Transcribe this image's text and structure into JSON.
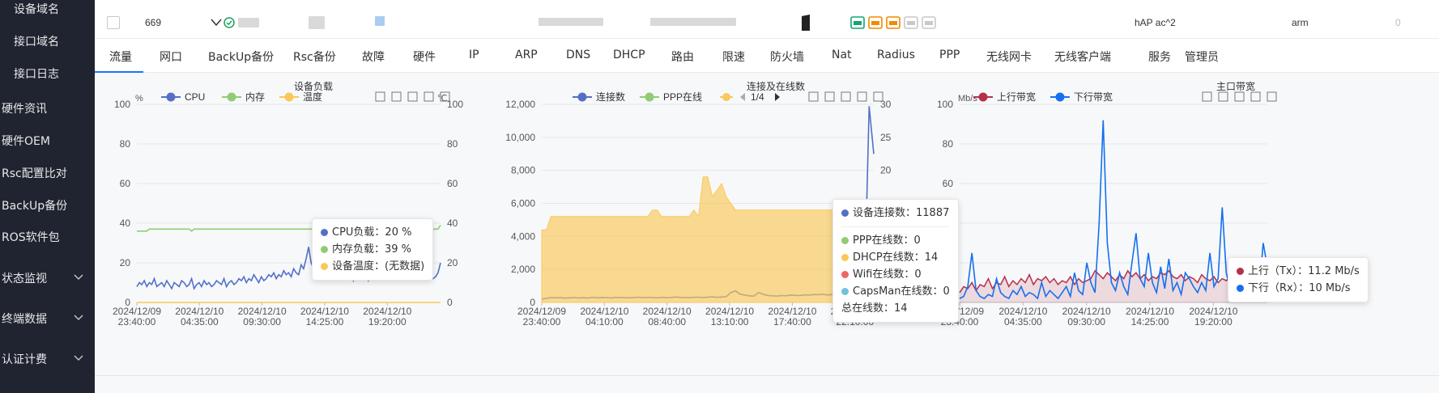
{
  "sidebar": {
    "items": [
      {
        "label": "设备域名",
        "indent": true
      },
      {
        "label": "接口域名",
        "indent": true
      },
      {
        "label": "接口日志",
        "indent": true
      },
      {
        "label": "硬件资讯"
      },
      {
        "label": "硬件OEM"
      },
      {
        "label": "Rsc配置比对"
      },
      {
        "label": "BackUp备份"
      },
      {
        "label": "ROS软件包"
      }
    ],
    "groups": [
      {
        "label": "状态监视",
        "icon": "chevron-down-icon"
      },
      {
        "label": "终端数据",
        "icon": "chevron-down-icon"
      },
      {
        "label": "认证计费",
        "icon": "chevron-down-icon"
      }
    ]
  },
  "device_row": {
    "id": "669",
    "model": "hAP ac^2",
    "arch": "arm",
    "count": "0",
    "status_colors": {
      "ok": "#19a15f",
      "port_active": "#f08c00",
      "port_inactive": "#c9c9c9",
      "port_up": "#18a374"
    }
  },
  "tabs": [
    "流量",
    "网口",
    "BackUp备份",
    "Rsc备份",
    "故障",
    "硬件",
    "IP",
    "ARP",
    "DNS",
    "DHCP",
    "路由",
    "限速",
    "防火墙",
    "Nat",
    "Radius",
    "PPP",
    "无线网卡",
    "无线客户端",
    "服务",
    "管理员"
  ],
  "active_tab": "流量",
  "panels": {
    "load": {
      "title": "设备负载"
    },
    "conn": {
      "title": "连接及在线数"
    },
    "bw": {
      "title": "主口带宽"
    }
  },
  "chart_data": [
    {
      "type": "line",
      "title": "设备负载",
      "ylabel_left": "%",
      "ylabel_right": "℃",
      "ylim": [
        0,
        100
      ],
      "ylim_right": [
        0,
        100
      ],
      "yticks": [
        0,
        20,
        40,
        60,
        80,
        100
      ],
      "xtick_labels": [
        [
          "2024/12/09",
          "23:40:00"
        ],
        [
          "2024/12/10",
          "04:35:00"
        ],
        [
          "2024/12/10",
          "09:30:00"
        ],
        [
          "2024/12/10",
          "14:25:00"
        ],
        [
          "2024/12/10",
          "19:20:00"
        ]
      ],
      "legend": [
        "CPU",
        "内存",
        "温度"
      ],
      "series": [
        {
          "name": "CPU",
          "color": "#5470c6",
          "values": [
            8,
            10,
            9,
            11,
            8,
            10,
            9,
            12,
            8,
            9,
            10,
            8,
            11,
            9,
            7,
            10,
            9,
            8,
            11,
            10,
            8,
            9,
            12,
            7,
            9,
            10,
            8,
            11,
            9,
            10,
            8,
            9,
            11,
            10,
            9,
            12,
            8,
            10,
            11,
            9,
            10,
            12,
            11,
            13,
            10,
            12,
            11,
            14,
            12,
            10,
            13,
            11,
            12,
            14,
            13,
            15,
            12,
            14,
            13,
            16,
            14,
            15,
            13,
            17,
            15,
            14,
            19,
            17,
            22,
            28,
            20,
            17,
            19,
            15,
            18,
            14,
            22,
            18,
            16,
            14,
            17,
            12,
            15,
            13,
            16,
            12,
            15,
            11,
            14,
            13,
            16,
            12,
            15,
            11,
            13,
            12,
            15,
            13,
            14,
            12,
            15,
            13,
            14,
            12,
            13,
            14,
            12,
            15,
            13,
            14,
            12,
            13,
            15,
            14,
            12,
            14,
            13,
            15,
            14,
            12,
            13,
            15,
            20
          ]
        },
        {
          "name": "内存",
          "color": "#91cc75",
          "values": [
            36,
            36,
            36,
            36,
            36,
            37,
            37,
            37,
            37,
            37,
            37,
            37,
            37,
            37,
            37,
            37,
            37,
            37,
            37,
            37,
            37,
            37,
            36,
            37,
            37,
            37,
            37,
            37,
            37,
            37,
            37,
            37,
            37,
            37,
            37,
            37,
            37,
            37,
            37,
            37,
            37,
            37,
            37,
            37,
            37,
            37,
            37,
            37,
            37,
            37,
            37,
            37,
            37,
            37,
            37,
            37,
            37,
            37,
            37,
            37,
            37,
            37,
            37,
            37,
            37,
            37,
            37,
            37,
            37,
            37,
            37,
            37,
            37,
            37,
            37,
            37,
            37,
            37,
            37,
            37,
            37,
            37,
            37,
            37,
            37,
            37,
            37,
            37,
            37,
            37,
            37,
            37,
            37,
            37,
            37,
            37,
            37,
            37,
            37,
            37,
            37,
            37,
            37,
            37,
            37,
            37,
            37,
            37,
            37,
            37,
            37,
            37,
            37,
            37,
            37,
            37,
            37,
            37,
            37,
            37,
            37,
            37,
            39
          ]
        },
        {
          "name": "温度",
          "color": "#fac858",
          "values": [
            0,
            0,
            0,
            0,
            0,
            0,
            0,
            0,
            0,
            0,
            0,
            0,
            0,
            0,
            0,
            0,
            0,
            0,
            0,
            0,
            0,
            0,
            0,
            0,
            0,
            0,
            0,
            0,
            0,
            0,
            0,
            0,
            0,
            0,
            0,
            0,
            0,
            0,
            0,
            0,
            0,
            0,
            0,
            0,
            0,
            0,
            0,
            0,
            0,
            0,
            0,
            0,
            0,
            0,
            0,
            0,
            0,
            0,
            0,
            0,
            0,
            0,
            0,
            0,
            0,
            0,
            0,
            0,
            0,
            0,
            0,
            0,
            0,
            0,
            0,
            0,
            0,
            0,
            0,
            0,
            0,
            0,
            0,
            0,
            0,
            0,
            0,
            0,
            0,
            0,
            0,
            0,
            0,
            0,
            0,
            0,
            0,
            0,
            0,
            0,
            0,
            0,
            0,
            0,
            0,
            0,
            0,
            0,
            0,
            0,
            0,
            0,
            0,
            0,
            0,
            0,
            0,
            0,
            0,
            0,
            0,
            0,
            0
          ]
        }
      ],
      "tooltip": [
        {
          "label": "CPU负载：20 %",
          "color": "#5470c6"
        },
        {
          "label": "内存负载：39 %",
          "color": "#91cc75"
        },
        {
          "label": "设备温度：(无数据)",
          "color": "#fac858"
        }
      ]
    },
    {
      "type": "area",
      "title": "连接及在线数",
      "ylim": [
        0,
        12000
      ],
      "ylim_right": [
        0,
        30
      ],
      "yticks": [
        0,
        2000,
        4000,
        6000,
        8000,
        10000,
        12000
      ],
      "yticks_right": [
        0,
        5,
        10,
        15,
        20,
        25,
        30
      ],
      "xtick_labels": [
        [
          "2024/12/09",
          "23:40:00"
        ],
        [
          "2024/12/10",
          "04:10:00"
        ],
        [
          "2024/12/10",
          "08:40:00"
        ],
        [
          "2024/12/10",
          "13:10:00"
        ],
        [
          "2024/12/10",
          "17:40:00"
        ],
        [
          "2024/12/10",
          "22:10:00"
        ]
      ],
      "legend": [
        "连接数",
        "PPP在线"
      ],
      "legend_page": "1/4",
      "series": [
        {
          "name": "连接数",
          "color": "#5470c6",
          "axis": "left",
          "values": [
            200,
            250,
            300,
            280,
            300,
            260,
            280,
            300,
            270,
            290,
            260,
            310,
            280,
            300,
            290,
            270,
            310,
            300,
            290,
            280,
            300,
            320,
            290,
            310,
            300,
            280,
            310,
            290,
            300,
            330,
            310,
            300,
            290,
            310,
            320,
            300,
            320,
            340,
            310,
            330,
            350,
            600,
            700,
            500,
            450,
            400,
            380,
            600,
            500,
            420,
            400,
            380,
            420,
            400,
            450,
            430,
            420,
            460,
            440,
            480,
            470,
            500,
            450,
            480,
            500,
            460,
            520,
            480,
            500,
            650,
            700,
            11887,
            9000
          ]
        },
        {
          "name": "DHCP在线",
          "color": "#fac858",
          "axis": "right",
          "values": [
            11,
            11,
            13,
            13,
            13,
            13,
            13,
            13,
            13,
            13,
            13,
            13,
            13,
            13,
            13,
            13,
            13,
            13,
            13,
            13,
            13,
            13,
            13,
            13,
            14,
            14,
            13,
            13,
            13,
            13,
            13,
            13,
            13,
            14,
            13,
            19,
            19,
            16,
            17,
            18,
            16,
            15,
            14,
            14,
            14,
            14,
            14,
            14,
            14,
            14,
            14,
            14,
            14,
            14,
            14,
            14,
            14,
            14,
            14,
            14,
            14,
            14,
            14,
            14,
            14,
            14,
            14,
            14,
            14,
            14,
            14,
            14,
            14
          ]
        }
      ],
      "tooltip": [
        {
          "label": "设备连接数：11887",
          "color": "#5470c6"
        },
        {
          "sep": true
        },
        {
          "label": "PPP在线数：0",
          "color": "#91cc75"
        },
        {
          "label": "DHCP在线数：14",
          "color": "#fac858"
        },
        {
          "label": "Wifi在线数：0",
          "color": "#ee6666"
        },
        {
          "label": "CapsMan在线数：0",
          "color": "#73c0de"
        },
        {
          "label": "总在线数：14"
        }
      ]
    },
    {
      "type": "line",
      "title": "主口带宽",
      "ylabel_left": "Mb/s",
      "ylim": [
        0,
        100
      ],
      "yticks": [
        0,
        20,
        40,
        60,
        80,
        100
      ],
      "xtick_labels": [
        [
          "2024/12/09",
          "23:40:00"
        ],
        [
          "2024/12/10",
          "04:35:00"
        ],
        [
          "2024/12/10",
          "09:30:00"
        ],
        [
          "2024/12/10",
          "14:25:00"
        ],
        [
          "2024/12/10",
          "19:20:00"
        ]
      ],
      "legend": [
        "上行带宽",
        "下行带宽"
      ],
      "series": [
        {
          "name": "上行带宽",
          "color": "#b5304a",
          "values": [
            5,
            8,
            7,
            10,
            6,
            9,
            8,
            12,
            7,
            10,
            9,
            13,
            8,
            11,
            9,
            12,
            10,
            14,
            9,
            12,
            11,
            13,
            10,
            12,
            9,
            11,
            10,
            13,
            9,
            12,
            10,
            11,
            12,
            16,
            14,
            12,
            15,
            13,
            11,
            14,
            12,
            16,
            13,
            15,
            12,
            14,
            11,
            13,
            12,
            15,
            14,
            16,
            13,
            12,
            14,
            11,
            13,
            12,
            10,
            14,
            12,
            11,
            13,
            10,
            12,
            11,
            13,
            9,
            12,
            11,
            13,
            10,
            12,
            11,
            9,
            11
          ]
        },
        {
          "name": "下行带宽",
          "color": "#1570ef",
          "values": [
            2,
            3,
            8,
            25,
            6,
            3,
            2,
            4,
            3,
            12,
            5,
            3,
            2,
            6,
            4,
            8,
            3,
            5,
            4,
            2,
            10,
            3,
            6,
            4,
            2,
            5,
            8,
            3,
            15,
            6,
            4,
            20,
            10,
            5,
            40,
            92,
            30,
            10,
            6,
            15,
            8,
            4,
            20,
            35,
            12,
            8,
            25,
            10,
            5,
            18,
            7,
            22,
            6,
            10,
            4,
            15,
            12,
            8,
            5,
            10,
            6,
            25,
            8,
            12,
            48,
            15,
            6,
            10,
            20,
            8,
            12,
            4,
            15,
            6,
            30,
            18
          ]
        }
      ],
      "tooltip": [
        {
          "label": "上行（Tx）：11.2 Mb/s",
          "color": "#b5304a"
        },
        {
          "label": "下行（Rx）：10 Mb/s",
          "color": "#1570ef"
        }
      ]
    }
  ]
}
